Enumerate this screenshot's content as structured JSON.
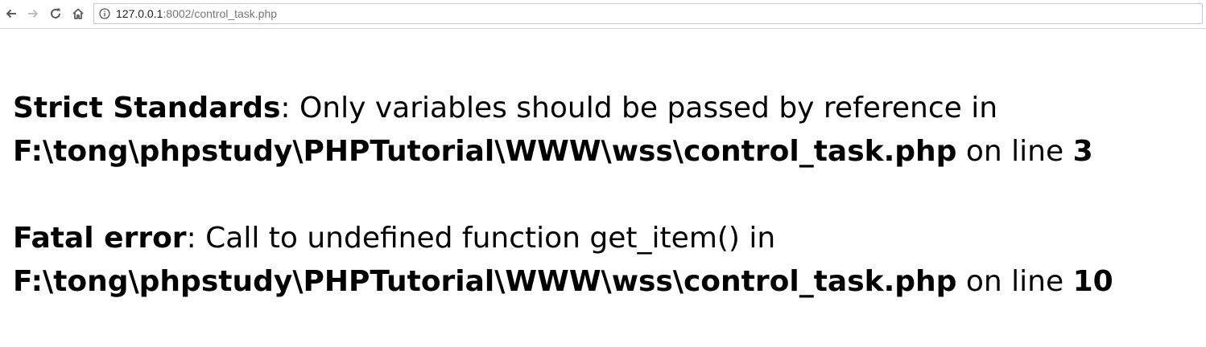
{
  "browser": {
    "url_host": "127.0.0.1",
    "url_rest": ":8002/control_task.php",
    "icons": {
      "back": "arrow-left-icon",
      "forward": "arrow-right-icon",
      "reload": "reload-icon",
      "home": "home-icon",
      "site_info": "info-icon"
    }
  },
  "errors": [
    {
      "type": "Strict Standards",
      "message": ": Only variables should be passed by reference in",
      "file": "F:\\tong\\phpstudy\\PHPTutorial\\WWW\\wss\\control_task.php",
      "on_line_text": " on line ",
      "line": "3"
    },
    {
      "type": "Fatal error",
      "message": ": Call to undefined function get_item() in",
      "file": "F:\\tong\\phpstudy\\PHPTutorial\\WWW\\wss\\control_task.php",
      "on_line_text": " on line ",
      "line": "10"
    }
  ]
}
